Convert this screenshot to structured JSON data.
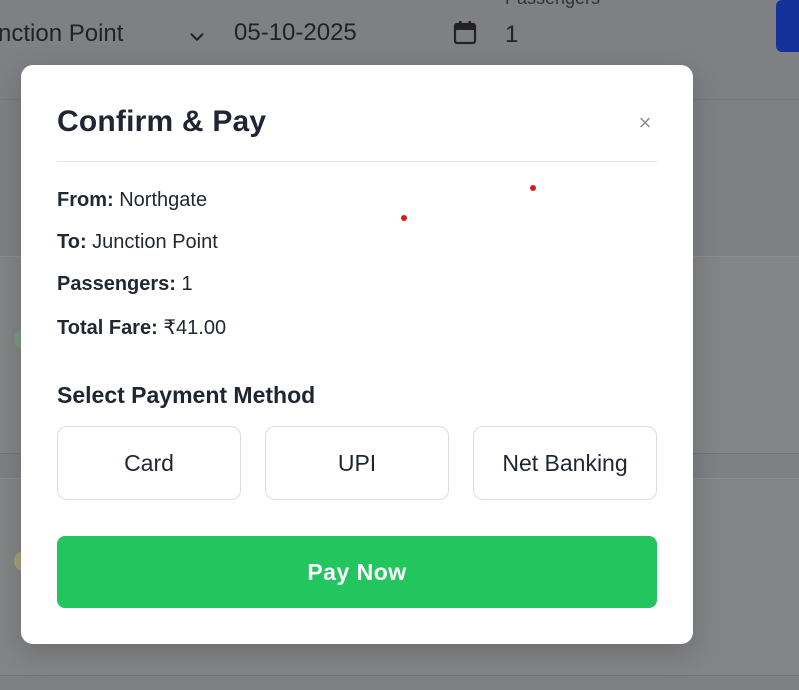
{
  "background": {
    "route_to_value": "nction Point",
    "date_value": "05-10-2025",
    "passengers_label": "Passengers",
    "passengers_value": "1"
  },
  "modal": {
    "title": "Confirm & Pay",
    "close_symbol": "×",
    "summary": {
      "from_label": "From:",
      "from_value": "Northgate",
      "to_label": "To:",
      "to_value": "Junction Point",
      "passengers_label": "Passengers:",
      "passengers_value": "1",
      "fare_label": "Total Fare:",
      "fare_value": "₹41.00"
    },
    "payment_section_title": "Select Payment Method",
    "payment_methods": [
      "Card",
      "UPI",
      "Net Banking"
    ],
    "pay_button_label": "Pay Now"
  },
  "colors": {
    "overlay": "#7f8083",
    "primary_green": "#22c55e",
    "accent_blue": "#16309a",
    "text_dark": "#1f2533"
  },
  "icons": {
    "close": "close-icon",
    "dropdown": "chevron-down-icon",
    "date": "calendar-icon"
  }
}
